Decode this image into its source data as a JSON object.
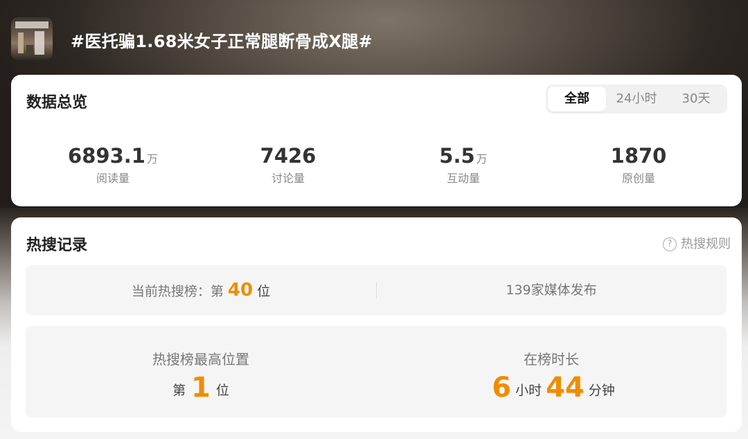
{
  "topic": {
    "title": "#医托骗1.68米女子正常腿断骨成X腿#"
  },
  "overview": {
    "title": "数据总览",
    "tabs": [
      {
        "label": "全部",
        "active": true
      },
      {
        "label": "24小时",
        "active": false
      },
      {
        "label": "30天",
        "active": false
      }
    ],
    "stats": [
      {
        "value": "6893.1",
        "unit": "万",
        "label": "阅读量"
      },
      {
        "value": "7426",
        "unit": "",
        "label": "讨论量"
      },
      {
        "value": "5.5",
        "unit": "万",
        "label": "互动量"
      },
      {
        "value": "1870",
        "unit": "",
        "label": "原创量"
      }
    ]
  },
  "hot_search": {
    "title": "热搜记录",
    "rules_label": "热搜规则",
    "current_rank_prefix": "当前热搜榜：第",
    "current_rank": "40",
    "rank_suffix": "位",
    "media_text": "139家媒体发布",
    "highest_title": "热搜榜最高位置",
    "highest_prefix": "第",
    "highest_rank": "1",
    "highest_suffix": "位",
    "duration_title": "在榜时长",
    "duration_hours": "6",
    "hours_unit": "小时",
    "duration_minutes": "44",
    "minutes_unit": "分钟"
  },
  "colors": {
    "accent": "#f08c00",
    "card_bg": "#ffffff",
    "inner_box": "#f5f5f5"
  }
}
